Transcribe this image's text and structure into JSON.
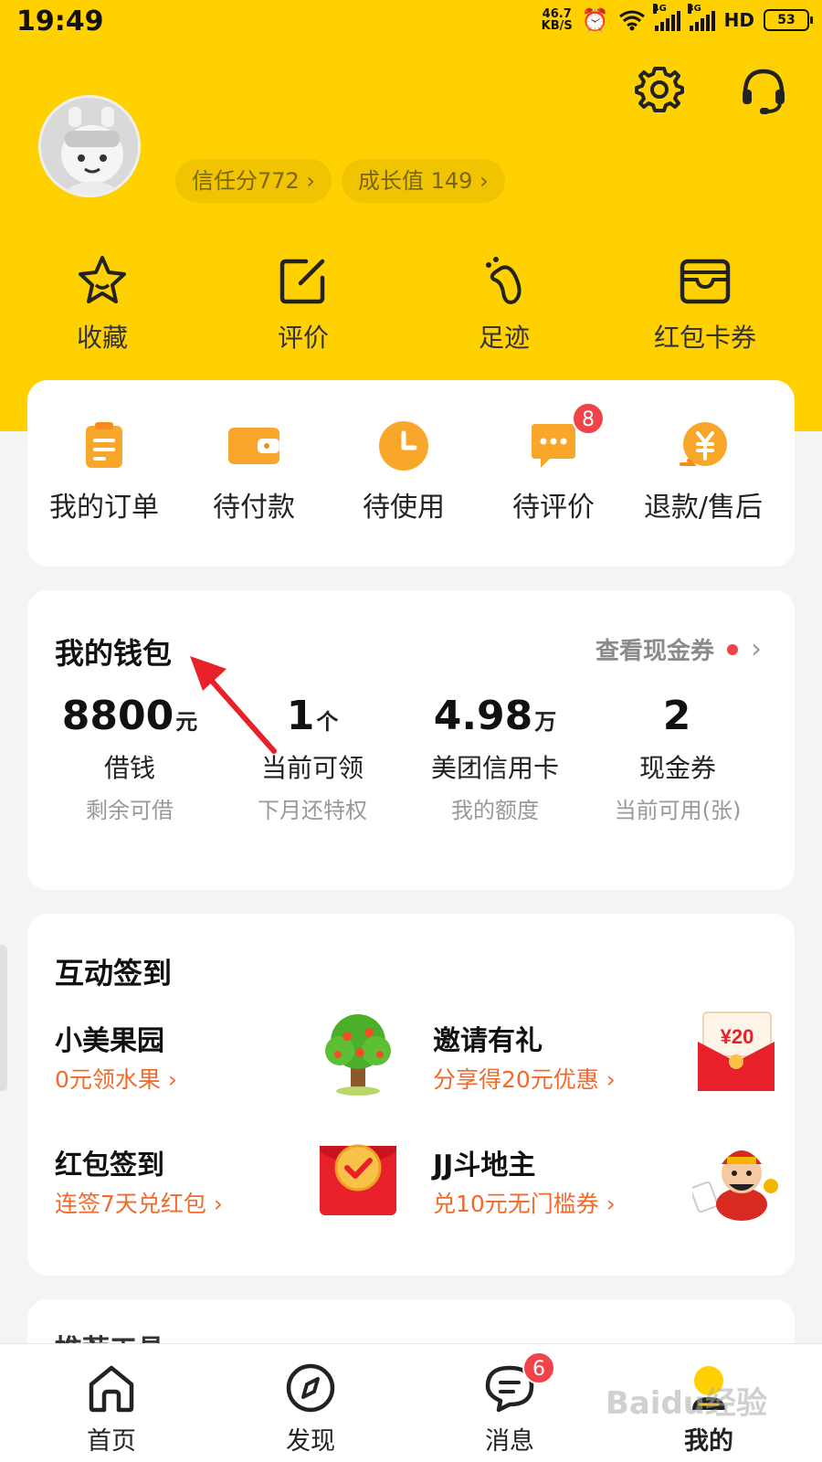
{
  "status_bar": {
    "time": "19:49",
    "speed_top": "46.7",
    "speed_bottom": "KB/S",
    "net1": "4G",
    "net2": "3G",
    "hd": "HD",
    "battery": "53"
  },
  "profile": {
    "trust_label": "信任分772 ›",
    "growth_label": "成长值 149 ›"
  },
  "quick_links": [
    {
      "label": "收藏",
      "icon": "star-icon"
    },
    {
      "label": "评价",
      "icon": "edit-icon"
    },
    {
      "label": "足迹",
      "icon": "footprint-icon"
    },
    {
      "label": "红包卡券",
      "icon": "wallet-card-icon"
    }
  ],
  "orders": [
    {
      "label": "我的订单",
      "icon": "order-list-icon"
    },
    {
      "label": "待付款",
      "icon": "pending-payment-icon"
    },
    {
      "label": "待使用",
      "icon": "clock-icon"
    },
    {
      "label": "待评价",
      "icon": "chat-bubble-icon",
      "badge": "8"
    },
    {
      "label": "退款/售后",
      "icon": "refund-icon"
    }
  ],
  "wallet": {
    "title": "我的钱包",
    "link": "查看现金券",
    "chevron": "›",
    "stats": [
      {
        "value": "8800",
        "unit": "元",
        "name": "借钱",
        "sub": "剩余可借"
      },
      {
        "value": "1",
        "unit": "个",
        "name": "当前可领",
        "sub": "下月还特权"
      },
      {
        "value": "4.98",
        "unit": "万",
        "name": "美团信用卡",
        "sub": "我的额度"
      },
      {
        "value": "2",
        "unit": "",
        "name": "现金券",
        "sub": "当前可用(张)"
      }
    ]
  },
  "checkin": {
    "title": "互动签到",
    "items": [
      {
        "title": "小美果园",
        "sub": "0元领水果 ›",
        "icon": "tree-icon"
      },
      {
        "title": "邀请有礼",
        "sub": "分享得20元优惠 ›",
        "icon": "red-envelope-20-icon",
        "envelope_text": "¥20"
      },
      {
        "title": "红包签到",
        "sub": "连签7天兑红包 ›",
        "icon": "red-envelope-check-icon"
      },
      {
        "title": "JJ斗地主",
        "sub": "兑10元无门槛券 ›",
        "icon": "god-of-wealth-icon"
      }
    ]
  },
  "recommend": {
    "title": "推荐工具"
  },
  "tabbar": [
    {
      "label": "首页",
      "icon": "home-icon"
    },
    {
      "label": "发现",
      "icon": "compass-icon"
    },
    {
      "label": "消息",
      "icon": "message-icon",
      "badge": "6"
    },
    {
      "label": "我的",
      "icon": "profile-icon"
    }
  ],
  "watermark": "Baidu经验",
  "colors": {
    "brand_yellow": "#ffd100",
    "badge_red": "#f2434b",
    "accent_orange": "#f26a2b"
  }
}
